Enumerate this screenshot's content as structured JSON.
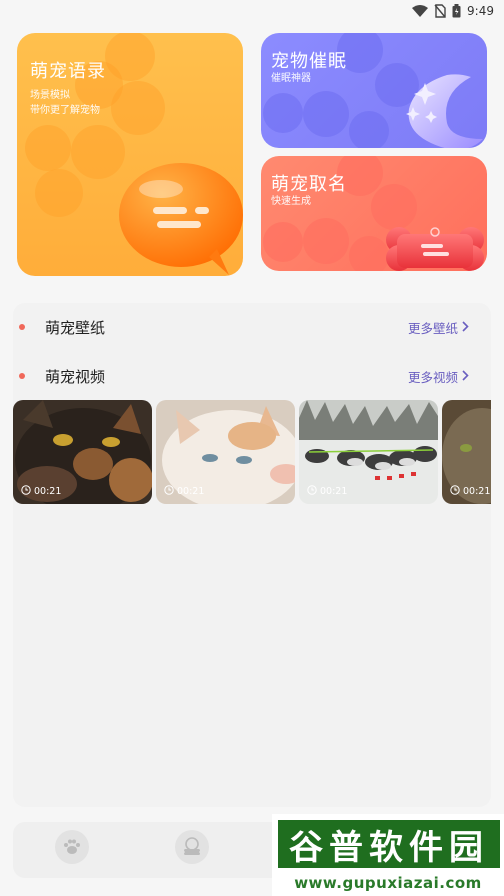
{
  "status_bar": {
    "time": "9:49",
    "icons": [
      "wifi-icon",
      "no-sim-icon",
      "battery-icon"
    ]
  },
  "cards": {
    "quotes": {
      "title": "萌宠语录",
      "sub1": "场景模拟",
      "sub2": "带你更了解宠物"
    },
    "hypnosis": {
      "title": "宠物催眠",
      "sub": "催眠神器"
    },
    "naming": {
      "title": "萌宠取名",
      "sub": "快速生成"
    }
  },
  "sections": {
    "wallpaper": {
      "title": "萌宠壁纸",
      "more": "更多壁纸"
    },
    "video": {
      "title": "萌宠视频",
      "more": "更多视频"
    }
  },
  "videos": [
    {
      "duration": "00:21",
      "subject": "tortoiseshell-cat"
    },
    {
      "duration": "00:21",
      "subject": "white-orange-cat"
    },
    {
      "duration": "00:21",
      "subject": "sled-dogs"
    },
    {
      "duration": "00:21",
      "subject": "cat"
    }
  ],
  "tabbar": {
    "icons": [
      "paw-icon",
      "bone-icon"
    ]
  },
  "watermark": {
    "title": "谷普软件园",
    "url": "www.gupuxiazai.com"
  },
  "colors": {
    "quotes_card": "#ffb23f",
    "hypnosis_card": "#8585fb",
    "naming_card": "#ff7a66",
    "accent_link": "#6a5fc0",
    "dot": "#f0685a"
  }
}
